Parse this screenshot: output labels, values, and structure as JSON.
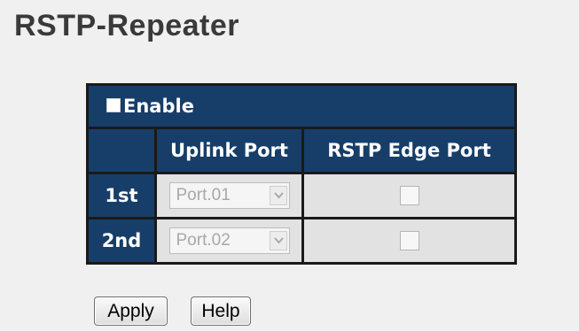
{
  "page": {
    "title": "RSTP-Repeater"
  },
  "table": {
    "enable_label": "Enable",
    "enable_checked": false,
    "columns": [
      "",
      "Uplink Port",
      "RSTP Edge Port"
    ],
    "rows": [
      {
        "label": "1st",
        "uplink_port": "Port.01",
        "rstp_edge_port_checked": false
      },
      {
        "label": "2nd",
        "uplink_port": "Port.02",
        "rstp_edge_port_checked": false
      }
    ]
  },
  "buttons": {
    "apply_label": "Apply",
    "help_label": "Help"
  },
  "colors": {
    "header_bg": "#173e69",
    "cell_bg": "#e2e2e2",
    "page_bg": "#f0f0f0",
    "border": "#1a1a1a"
  }
}
